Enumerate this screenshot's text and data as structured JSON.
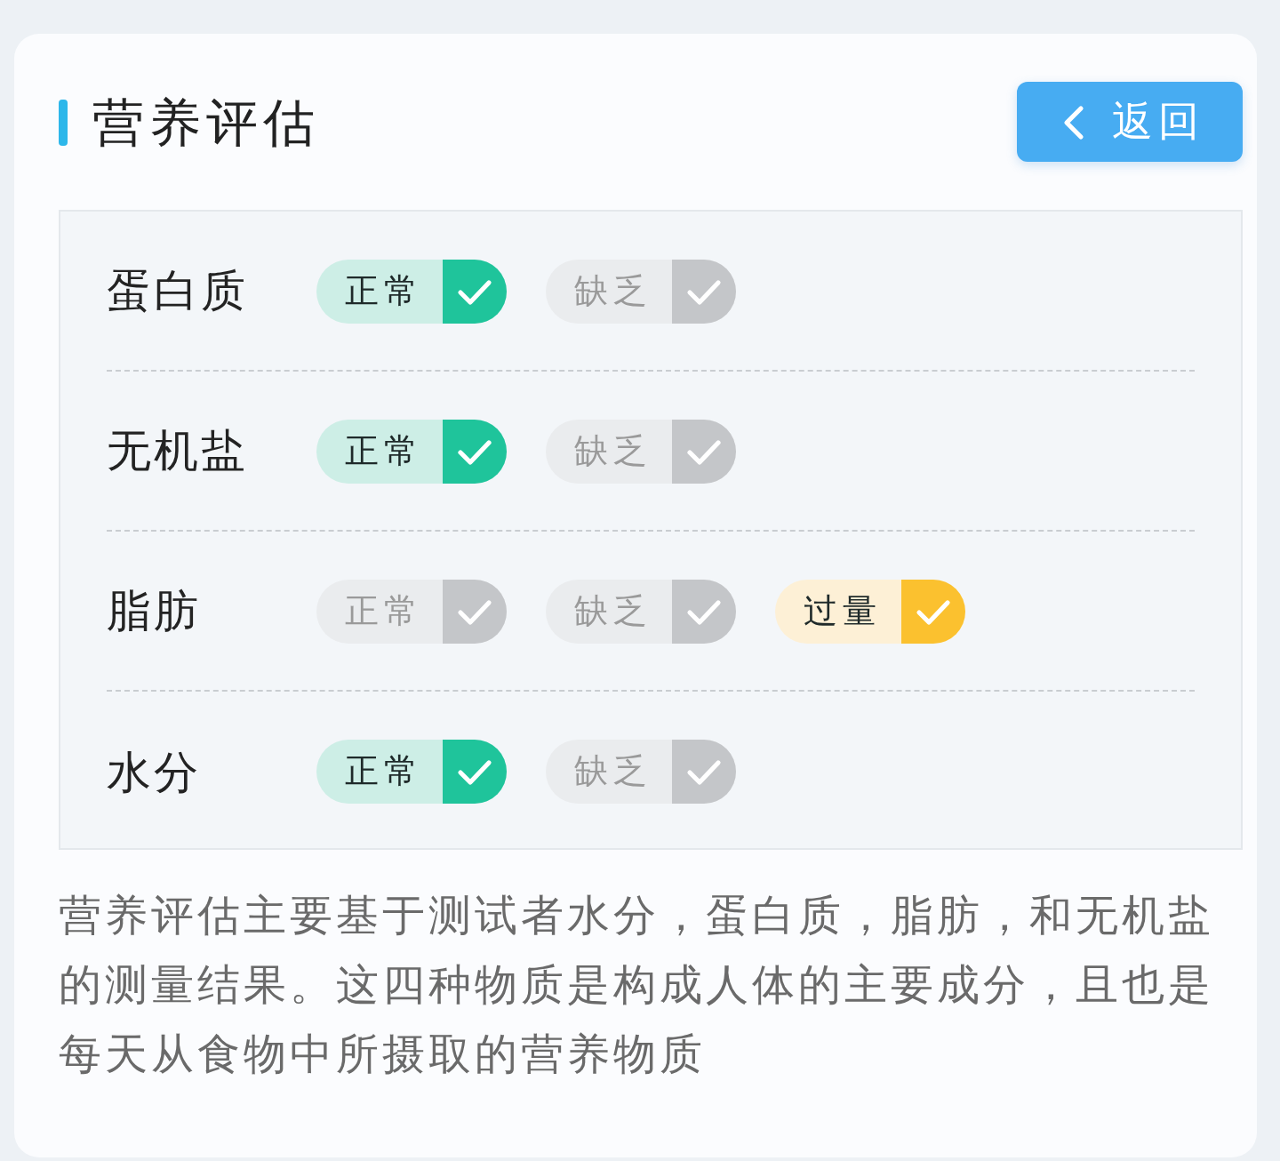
{
  "header": {
    "title": "营养评估",
    "back_button": {
      "label": "返回"
    }
  },
  "nutrients": [
    {
      "name": "蛋白质",
      "options": [
        {
          "label": "正常",
          "kind": "normal",
          "checked": true
        },
        {
          "label": "缺乏",
          "kind": "deficient",
          "checked": false
        }
      ]
    },
    {
      "name": "无机盐",
      "options": [
        {
          "label": "正常",
          "kind": "normal",
          "checked": true
        },
        {
          "label": "缺乏",
          "kind": "deficient",
          "checked": false
        }
      ]
    },
    {
      "name": "脂肪",
      "options": [
        {
          "label": "正常",
          "kind": "normal",
          "checked": false
        },
        {
          "label": "缺乏",
          "kind": "deficient",
          "checked": false
        },
        {
          "label": "过量",
          "kind": "excess",
          "checked": true
        }
      ]
    },
    {
      "name": "水分",
      "options": [
        {
          "label": "正常",
          "kind": "normal",
          "checked": true
        },
        {
          "label": "缺乏",
          "kind": "deficient",
          "checked": false
        }
      ]
    }
  ],
  "description": "营养评估主要基于测试者水分，蛋白质，脂肪，和无机盐的测量结果。这四种物质是构成人体的主要成分，且也是每天从食物中所摄取的营养物质"
}
